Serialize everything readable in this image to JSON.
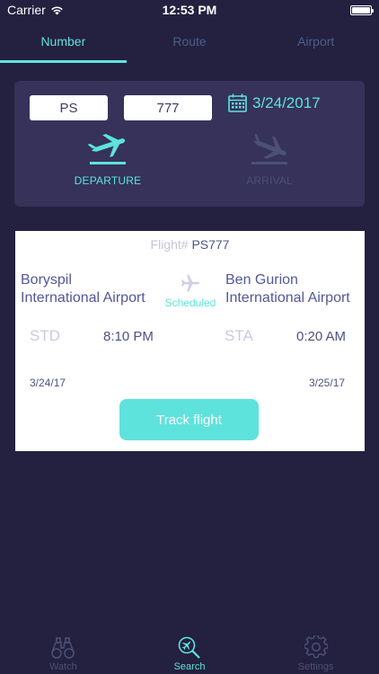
{
  "status_bar": {
    "carrier": "Carrier",
    "time": "12:53 PM"
  },
  "tabs": [
    {
      "label": "Number",
      "active": true
    },
    {
      "label": "Route",
      "active": false
    },
    {
      "label": "Airport",
      "active": false
    }
  ],
  "search": {
    "airline_code": "PS",
    "flight_number": "777",
    "date": "3/24/2017",
    "departure_label": "DEPARTURE",
    "arrival_label": "ARRIVAL",
    "selected": "departure"
  },
  "result": {
    "flight_label": "Flight#",
    "flight_number": "PS777",
    "from_airport_line1": "Boryspil",
    "from_airport_line2": "International Airport",
    "to_airport_line1": "Ben Gurion",
    "to_airport_line2": "International Airport",
    "status": "Scheduled",
    "std_label": "STD",
    "std_time": "8:10 PM",
    "sta_label": "STA",
    "sta_time": "0:20 AM",
    "dep_date": "3/24/17",
    "arr_date": "3/25/17",
    "track_label": "Track flight"
  },
  "tabbar": [
    {
      "label": "Watch",
      "icon": "binoculars-icon",
      "active": false
    },
    {
      "label": "Search",
      "icon": "search-plane-icon",
      "active": true
    },
    {
      "label": "Settings",
      "icon": "gear-icon",
      "active": false
    }
  ],
  "colors": {
    "background": "#24203f",
    "panel": "#36325a",
    "accent": "#5ee3dc",
    "muted": "#4d5e86"
  }
}
